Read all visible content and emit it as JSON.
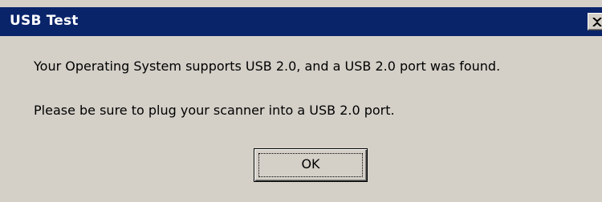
{
  "window": {
    "title": "USB Test"
  },
  "dialog": {
    "message_line1": "Your Operating System supports USB 2.0, and a USB 2.0 port was found.",
    "message_line2": "Please be sure to plug your scanner into a USB 2.0 port.",
    "ok_label": "OK"
  },
  "icons": {
    "close": "close-icon"
  },
  "colors": {
    "titlebar": "#0a246a",
    "title_text": "#ffffff",
    "dialog_background": "#d4d0c8"
  }
}
